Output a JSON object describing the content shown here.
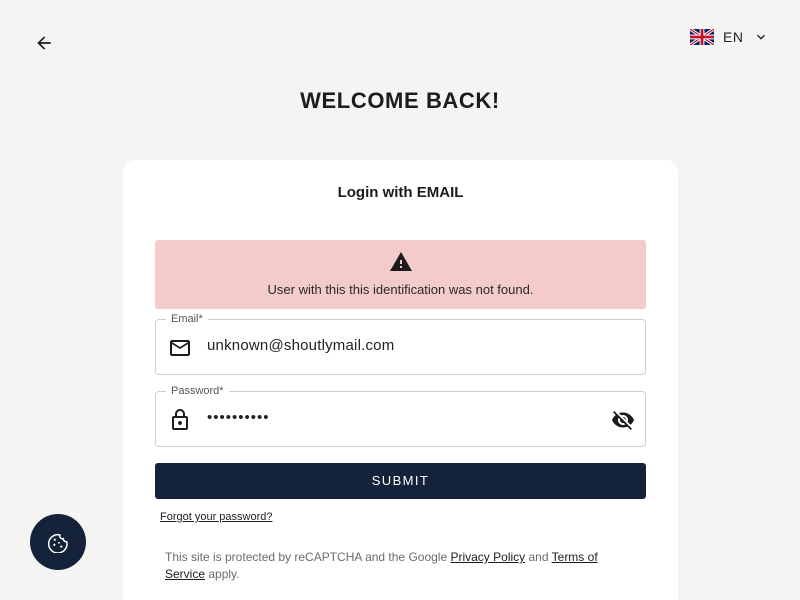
{
  "header": {
    "back_icon": "arrow-left-icon",
    "language": {
      "flag": "uk-flag-icon",
      "code": "EN",
      "chevron": "chevron-down-icon"
    }
  },
  "title": "WELCOME BACK!",
  "login_card": {
    "title": "Login with EMAIL",
    "alert": {
      "icon": "warning-icon",
      "message": "User with this this identification was not found."
    },
    "email": {
      "label": "Email*",
      "value": "unknown@shoutlymail.com",
      "icon": "mail-icon"
    },
    "password": {
      "label": "Password*",
      "value": "••••••••••",
      "icon": "lock-icon",
      "toggle_icon": "eye-off-icon"
    },
    "submit_label": "SUBMIT",
    "forgot_label": "Forgot your password?",
    "recaptcha": {
      "prefix": "This site is protected by reCAPTCHA and the Google ",
      "privacy_link": "Privacy Policy",
      "middle": " and ",
      "terms_link": "Terms of Service",
      "suffix": " apply."
    }
  },
  "cookie_button": {
    "icon": "cookie-icon"
  },
  "colors": {
    "primary": "#14233a",
    "alert_bg": "#f4cbcb",
    "page_bg": "#f4f4f2",
    "card_bg": "#ffffff"
  }
}
